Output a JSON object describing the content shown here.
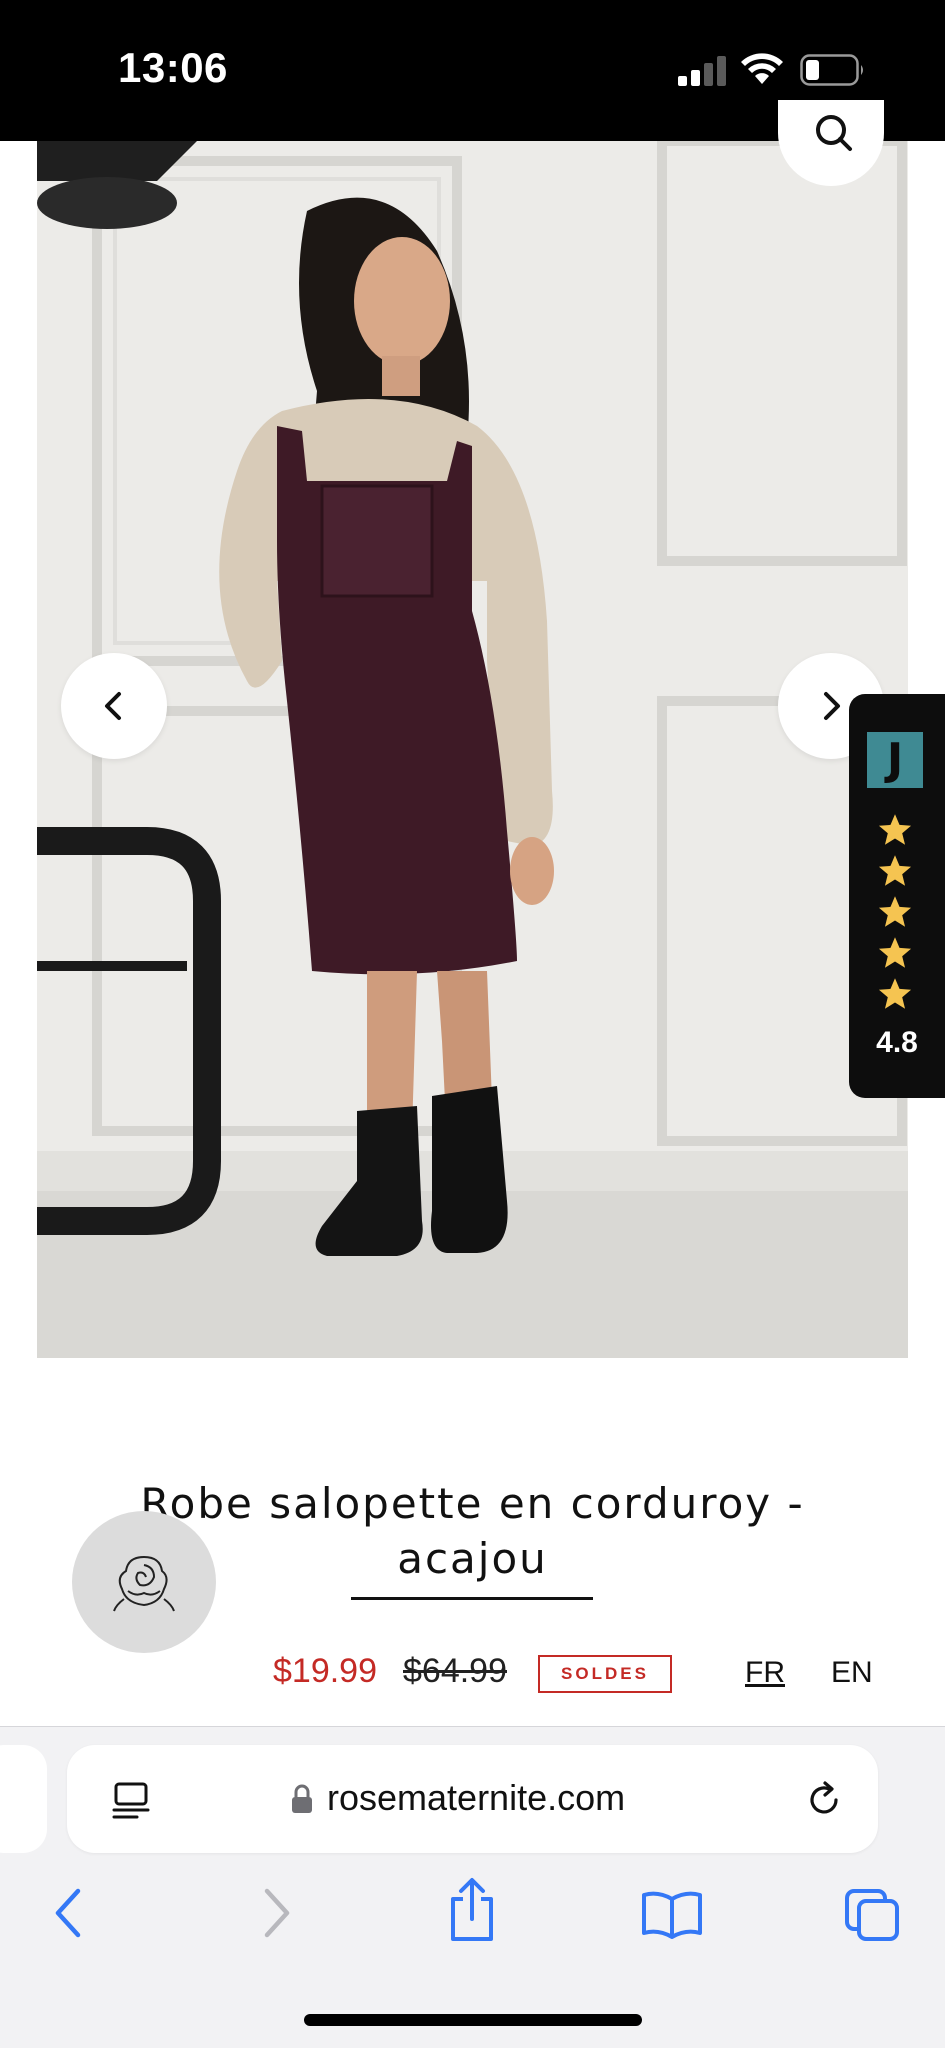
{
  "status_bar": {
    "time": "13:06",
    "signal_icon": "cellular-signal-icon",
    "wifi_icon": "wifi-icon",
    "battery_icon": "battery-low-icon"
  },
  "product": {
    "title": "Robe salopette en corduroy - acajou",
    "sale_price": "$19.99",
    "original_price": "$64.99",
    "badge": "SOLDES",
    "image_alt_icon": "product-photo"
  },
  "gallery": {
    "search_icon": "search-icon",
    "prev_icon": "chevron-left-icon",
    "next_icon": "chevron-right-icon"
  },
  "rating_widget": {
    "logo": "J",
    "stars": 5,
    "score": "4.8",
    "star_color": "#f5c451"
  },
  "languages": {
    "fr": "FR",
    "en": "EN"
  },
  "browser": {
    "url": "rosematernite.com"
  },
  "colors": {
    "sale_red": "#c42a25",
    "ios_blue": "#3478f6",
    "judge_teal": "#3f8a93"
  }
}
